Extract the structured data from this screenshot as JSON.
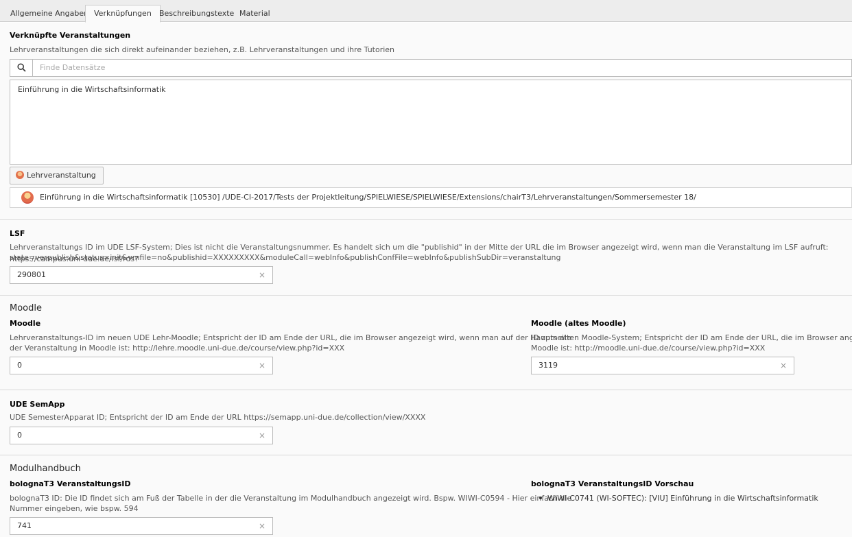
{
  "tabs": [
    "Allgemeine Angaben",
    "Verknüpfungen",
    "Beschreibungstexte",
    "Material"
  ],
  "linked": {
    "title": "Verknüpfte Veranstaltungen",
    "description": "Lehrveranstaltungen die sich direkt aufeinander beziehen, z.B. Lehrveranstaltungen und ihre Tutorien",
    "search_placeholder": "Finde Datensätze",
    "selected_item": "Einführung in die Wirtschaftsinformatik",
    "add_button_label": "Lehrveranstaltung",
    "record_text": "Einführung in die Wirtschaftsinformatik [10530] /UDE-CI-2017/Tests der Projektleitung/SPIELWIESE/SPIELWIESE/Extensions/chairT3/Lehrveranstaltungen/Sommersemester 18/"
  },
  "lsf": {
    "title": "LSF",
    "description_line1": "Lehrveranstaltungs ID im UDE LSF-System; Dies ist nicht die Veranstaltungsnummer. Es handelt sich um die \"publishid\" in der Mitte der URL die im Browser angezeigt wird, wenn man die Veranstaltung im LSF aufruft: https://campus.uni-due.de/lsf/rds?",
    "description_line2": "state=verpublish&status=init&vmfile=no&publishid=XXXXXXXXX&moduleCall=webInfo&publishConfFile=webInfo&publishSubDir=veranstaltung",
    "value": "290801"
  },
  "moodle": {
    "heading": "Moodle",
    "new": {
      "title": "Moodle",
      "description_line1": "Lehrveranstaltungs-ID im neuen UDE Lehr-Moodle; Entspricht der ID am Ende der URL, die im Browser angezeigt wird, wenn man auf der Hauptseite",
      "description_line2": "der Veranstaltung in Moodle ist: http://lehre.moodle.uni-due.de/course/view.php?id=XXX",
      "value": "0"
    },
    "old": {
      "title": "Moodle (altes Moodle)",
      "description_line1": "ID zum alten Moodle-System; Entspricht der ID am Ende der URL, die im Browser angezeigt wird",
      "description_line2": "Moodle ist: http://moodle.uni-due.de/course/view.php?id=XXX",
      "value": "3119"
    }
  },
  "semapp": {
    "title": "UDE SemApp",
    "description": "UDE SemesterApparat ID; Entspricht der ID am Ende der URL https://semapp.uni-due.de/collection/view/XXXX",
    "value": "0"
  },
  "modulhandbuch": {
    "heading": "Modulhandbuch",
    "id_field": {
      "title": "bolognaT3 VeranstaltungsID",
      "description_line1": "bolognaT3 ID: Die ID findet sich am Fuß der Tabelle in der die Veranstaltung im Modulhandbuch angezeigt wird. Bspw. WIWI-C0594 - Hier einfach die",
      "description_line2": "Nummer eingeben, wie bspw. 594",
      "value": "741"
    },
    "preview": {
      "title": "bolognaT3 VeranstaltungsID Vorschau",
      "items": [
        "WIWI-C0741 (WI-SOFTEC): [VIU] Einführung in die Wirtschaftsinformatik"
      ]
    }
  },
  "clear_symbol": "×"
}
